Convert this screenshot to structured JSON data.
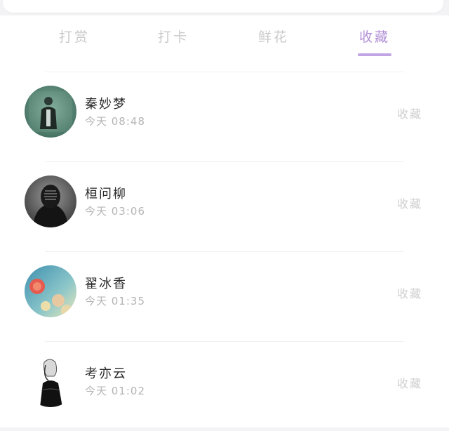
{
  "tabs": [
    {
      "label": "打赏"
    },
    {
      "label": "打卡"
    },
    {
      "label": "鲜花"
    },
    {
      "label": "收藏"
    }
  ],
  "active_tab": "收藏",
  "accent_color": "#b28fd6",
  "records": [
    {
      "name": "秦妙梦",
      "time": "今天 08:48",
      "status": "收藏",
      "avatar_icon": "person-photo-green"
    },
    {
      "name": "桓问柳",
      "time": "今天 03:06",
      "status": "收藏",
      "avatar_icon": "masked-person-photo"
    },
    {
      "name": "翟冰香",
      "time": "今天 01:35",
      "status": "收藏",
      "avatar_icon": "rose-flower-photo"
    },
    {
      "name": "考亦云",
      "time": "今天 01:02",
      "status": "收藏",
      "avatar_icon": "girl-sketch"
    }
  ]
}
